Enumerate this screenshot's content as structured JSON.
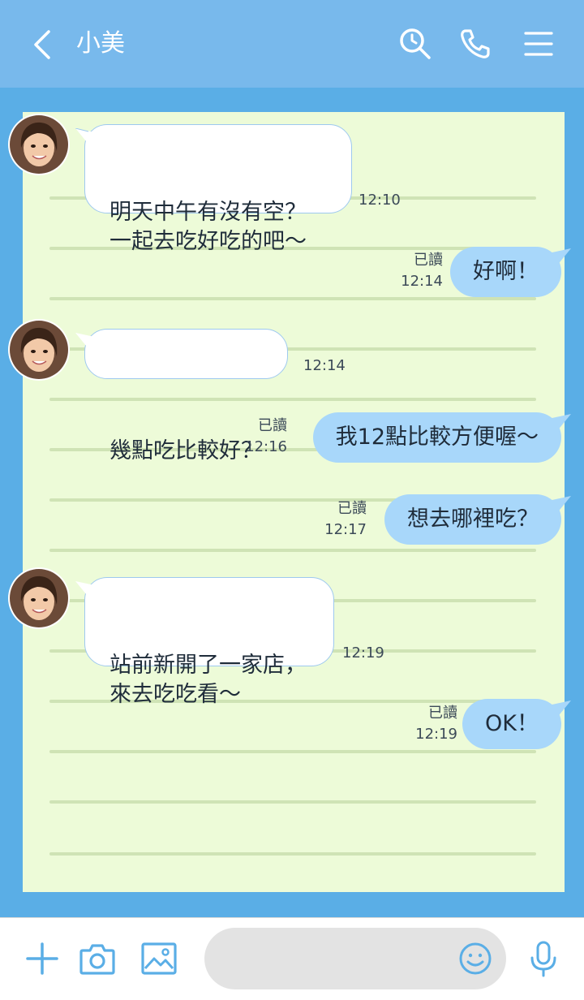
{
  "header": {
    "contact_name": "小美"
  },
  "messages": [
    {
      "direction": "incoming",
      "text": "明天中午有沒有空？\n一起去吃好吃的吧～",
      "time": "12:10"
    },
    {
      "direction": "outgoing",
      "text": "好啊！",
      "read_label": "已讀",
      "time": "12:14"
    },
    {
      "direction": "incoming",
      "text": "幾點吃比較好？",
      "time": "12:14"
    },
    {
      "direction": "outgoing",
      "text": "我12點比較方便喔～",
      "read_label": "已讀",
      "time": "12:16"
    },
    {
      "direction": "outgoing",
      "text": "想去哪裡吃？",
      "read_label": "已讀",
      "time": "12:17"
    },
    {
      "direction": "incoming",
      "text": "站前新開了一家店，\n來去吃吃看～",
      "time": "12:19"
    },
    {
      "direction": "outgoing",
      "text": "OK！",
      "read_label": "已讀",
      "time": "12:19"
    }
  ],
  "footer": {
    "input_value": "",
    "input_placeholder": ""
  },
  "icons": {
    "back": "chevron-left-icon",
    "search": "search-icon",
    "call": "phone-icon",
    "menu": "menu-icon",
    "add": "plus-icon",
    "camera": "camera-icon",
    "image": "image-icon",
    "emoji": "smiley-icon",
    "voice": "microphone-icon"
  },
  "colors": {
    "header": "#78b9ec",
    "background": "#5aaee6",
    "paper": "#edfbd8",
    "incoming_bubble": "#ffffff",
    "outgoing_bubble": "#a8d7fa",
    "icon_accent": "#5aaee6"
  }
}
